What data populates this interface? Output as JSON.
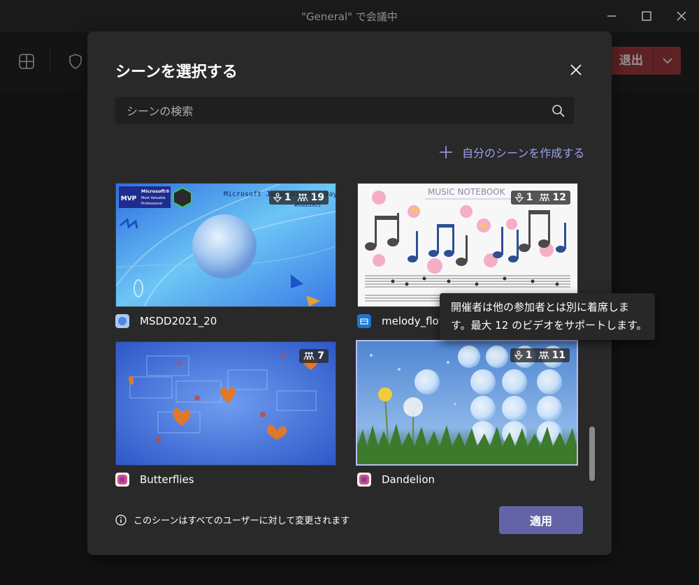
{
  "window": {
    "title": "\"General\" で会議中"
  },
  "toolbar": {
    "leave_label": "退出"
  },
  "dialog": {
    "title": "シーンを選択する",
    "search_placeholder": "シーンの検索",
    "create_label": "自分のシーンを作成する",
    "footer_info": "このシーンはすべてのユーザーに対して変更されます",
    "apply_label": "適用",
    "scenes": [
      {
        "name": "MSDD2021_20",
        "presenters": "1",
        "seats": "19",
        "selected": false
      },
      {
        "name": "melody_flow",
        "presenters": "1",
        "seats": "12",
        "selected": false,
        "notebook_title": "MUSIC NOTEBOOK"
      },
      {
        "name": "Butterflies",
        "presenters": "",
        "seats": "7",
        "selected": false
      },
      {
        "name": "Dandelion",
        "presenters": "1",
        "seats": "11",
        "selected": true
      }
    ],
    "thumbnail_text": {
      "mvp_line1": "Microsoft®",
      "mvp_line2": "Most Valuable",
      "mvp_line3": "Professional",
      "mvp_logo": "MVP",
      "event_text": "Microsoft Japan Digital Days",
      "event_code": "#MSDD2021"
    },
    "tooltip": {
      "line1": "開催者は他の参加者とは別に着席しま",
      "line2": "す。最大 12 のビデオをサポートします。"
    }
  },
  "colors": {
    "accent": "#6264a7",
    "link": "#9ba1ec",
    "leave": "#a43b3e",
    "selected_border": "#b9bcf3"
  }
}
